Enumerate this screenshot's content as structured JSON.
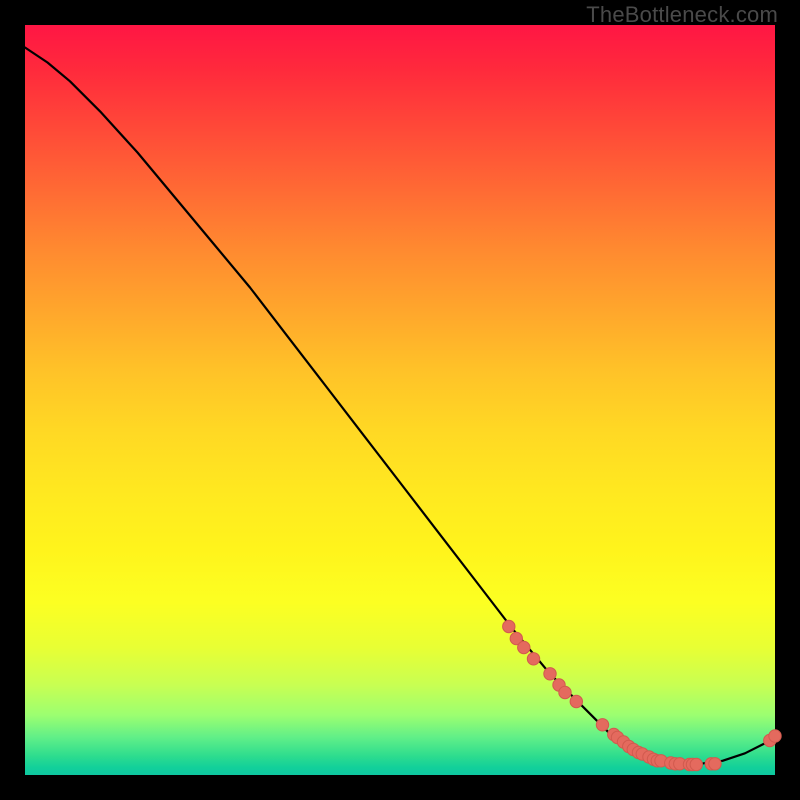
{
  "credit": "TheBottleneck.com",
  "chart_data": {
    "type": "line",
    "title": "",
    "xlabel": "",
    "ylabel": "",
    "xlim": [
      0,
      100
    ],
    "ylim": [
      0,
      100
    ],
    "curve_xy": [
      [
        0,
        97
      ],
      [
        3,
        95
      ],
      [
        6,
        92.5
      ],
      [
        10,
        88.5
      ],
      [
        15,
        83
      ],
      [
        20,
        77
      ],
      [
        25,
        71
      ],
      [
        30,
        65
      ],
      [
        35,
        58.5
      ],
      [
        40,
        52
      ],
      [
        45,
        45.5
      ],
      [
        50,
        39
      ],
      [
        55,
        32.5
      ],
      [
        60,
        26
      ],
      [
        65,
        19.5
      ],
      [
        70,
        13.5
      ],
      [
        75,
        8.5
      ],
      [
        78,
        5.5
      ],
      [
        80,
        3.8
      ],
      [
        83,
        2.3
      ],
      [
        86,
        1.6
      ],
      [
        90,
        1.5
      ],
      [
        93,
        1.9
      ],
      [
        96,
        2.9
      ],
      [
        99,
        4.4
      ],
      [
        100,
        5
      ]
    ],
    "points_xy": [
      [
        64.5,
        19.8
      ],
      [
        65.5,
        18.2
      ],
      [
        66.5,
        17.0
      ],
      [
        67.8,
        15.5
      ],
      [
        70.0,
        13.5
      ],
      [
        71.2,
        12.0
      ],
      [
        72.0,
        11.0
      ],
      [
        73.5,
        9.8
      ],
      [
        77.0,
        6.7
      ],
      [
        78.5,
        5.4
      ],
      [
        79.0,
        5.0
      ],
      [
        79.8,
        4.4
      ],
      [
        80.5,
        3.8
      ],
      [
        81.1,
        3.4
      ],
      [
        81.8,
        3.0
      ],
      [
        82.3,
        2.8
      ],
      [
        83.2,
        2.4
      ],
      [
        83.8,
        2.1
      ],
      [
        84.3,
        1.9
      ],
      [
        84.8,
        1.9
      ],
      [
        86.1,
        1.6
      ],
      [
        86.7,
        1.5
      ],
      [
        87.3,
        1.5
      ],
      [
        88.6,
        1.4
      ],
      [
        89.0,
        1.4
      ],
      [
        89.5,
        1.4
      ],
      [
        91.5,
        1.5
      ],
      [
        92.0,
        1.5
      ],
      [
        99.3,
        4.6
      ],
      [
        100.0,
        5.2
      ]
    ]
  }
}
